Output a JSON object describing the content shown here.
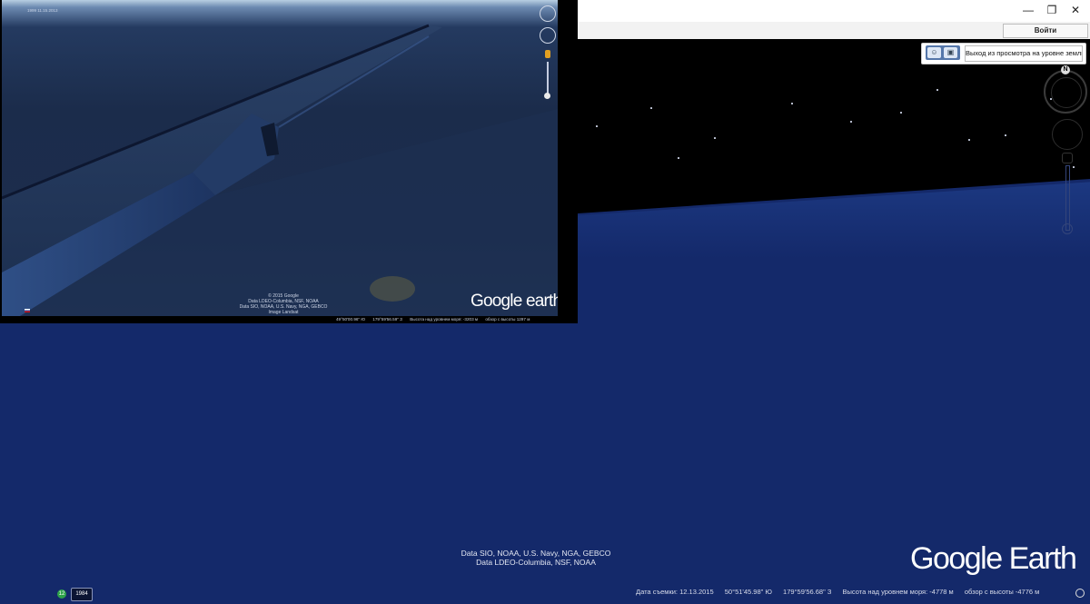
{
  "window": {
    "minimize_glyph": "—",
    "restore_glyph": "❐",
    "close_glyph": "✕",
    "signin_label": "Войти"
  },
  "controls": {
    "exit_ground_label": "Выход из просмотра на уровне земли",
    "north_label": "N"
  },
  "attribution": {
    "line1": "Data SIO, NOAA, U.S. Navy, NGA, GEBCO",
    "line2": "Data LDEO-Columbia, NSF, NOAA"
  },
  "logo": "Google Earth",
  "status": {
    "date": "Дата съемки: 12.13.2015",
    "lat": "50°51'45.98\" Ю",
    "lon": "179°59'56.68\" З",
    "elevation": "Высота над уровнем моря: -4778 м",
    "eye": "обзор с высоты -4776 м"
  },
  "taskbar": {
    "badge1": "12",
    "badge2": "1984"
  },
  "inset": {
    "date_text": "1999 11.15.2013",
    "attribution": {
      "line1": "© 2015 Google",
      "line2": "Data LDEO-Columbia, NSF, NOAA",
      "line3": "Data SIO, NOAA, U.S. Navy, NGA, GEBCO",
      "line4": "Image Landsat"
    },
    "logo": "Google earth",
    "status": {
      "lat": "49°50'00.96\" Ю",
      "lon": "179°59'56.59\" З",
      "elevation": "Высота над уровнем моря: -3203 м",
      "eye": "обзор с высоты 1297 м"
    }
  },
  "colors": {
    "ocean": "#14296a",
    "space": "#000000"
  }
}
